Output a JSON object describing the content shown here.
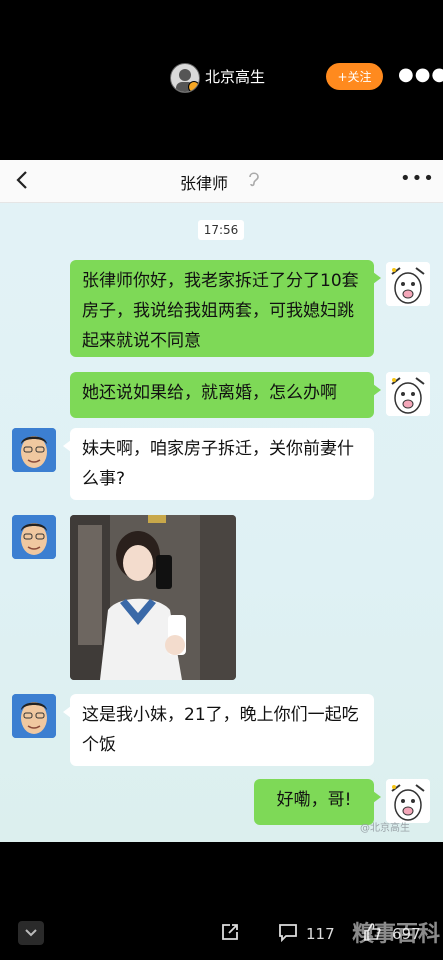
{
  "post": {
    "author": "北京高生",
    "follow_label": "+关注",
    "more_icon": "more-horizontal-icon"
  },
  "chat": {
    "back_icon": "chevron-left-icon",
    "contact_name": "张律师",
    "ear_icon": "ear-icon",
    "timestamp": "17:56",
    "messages": [
      {
        "from": "me",
        "text": "张律师你好，我老家拆迁了分了10套房子，我说给我姐两套，可我媳妇跳起来就说不同意"
      },
      {
        "from": "me",
        "text": "她还说如果给，就离婚，怎么办啊"
      },
      {
        "from": "other",
        "text": "妹夫啊，咱家房子拆迁，关你前妻什么事?"
      },
      {
        "from": "other",
        "type": "image"
      },
      {
        "from": "other",
        "text": "这是我小妹，21了，晚上你们一起吃个饭"
      },
      {
        "from": "me",
        "text": "好嘞，哥!"
      }
    ],
    "watermark": "@北京高生"
  },
  "footer": {
    "comment_count": "117",
    "like_count": "697",
    "site_watermark": "糗事百科"
  },
  "colors": {
    "accent": "#ff8a1e",
    "bubble_green": "#7ed957",
    "chat_bg": "#e3f2f6"
  }
}
